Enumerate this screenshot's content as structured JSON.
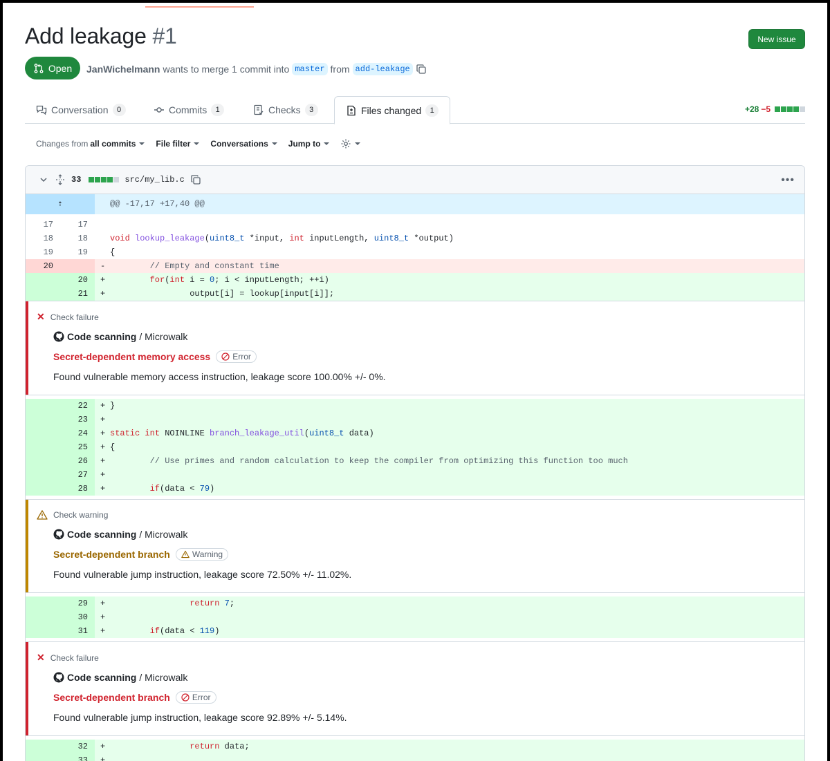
{
  "pr": {
    "title": "Add leakage",
    "number": "#1",
    "new_issue": "New issue",
    "state": "Open",
    "author": "JanWichelmann",
    "merge_text": "wants to merge 1 commit into",
    "base_branch": "master",
    "from_text": "from",
    "head_branch": "add-leakage"
  },
  "tabs": [
    {
      "label": "Conversation",
      "count": "0"
    },
    {
      "label": "Commits",
      "count": "1"
    },
    {
      "label": "Checks",
      "count": "3"
    },
    {
      "label": "Files changed",
      "count": "1"
    }
  ],
  "diffstat": {
    "additions": "+28",
    "deletions": "−5"
  },
  "toolbar": {
    "changes_prefix": "Changes from",
    "changes_value": "all commits",
    "file_filter": "File filter",
    "conversations": "Conversations",
    "jump_to": "Jump to"
  },
  "file": {
    "changes": "33",
    "name": "src/my_lib.c"
  },
  "hunk_header": "@@ -17,17 +17,40 @@",
  "annotations": [
    {
      "kind": "Check failure",
      "source_bold": "Code scanning",
      "source_rest": "/ Microwalk",
      "title": "Secret-dependent memory access",
      "level": "Error",
      "message": "Found vulnerable memory access instruction, leakage score 100.00% +/- 0%."
    },
    {
      "kind": "Check warning",
      "source_bold": "Code scanning",
      "source_rest": "/ Microwalk",
      "title": "Secret-dependent branch",
      "level": "Warning",
      "message": "Found vulnerable jump instruction, leakage score 72.50% +/- 11.02%."
    },
    {
      "kind": "Check failure",
      "source_bold": "Code scanning",
      "source_rest": "/ Microwalk",
      "title": "Secret-dependent branch",
      "level": "Error",
      "message": "Found vulnerable jump instruction, leakage score 92.89% +/- 5.14%."
    }
  ],
  "colors": {
    "open_green": "#1f883d",
    "error_red": "#d1242f",
    "warning_amber": "#9a6700",
    "add_bg": "#e6ffec",
    "del_bg": "#ffebe9",
    "hunk_bg": "#ddf4ff"
  }
}
